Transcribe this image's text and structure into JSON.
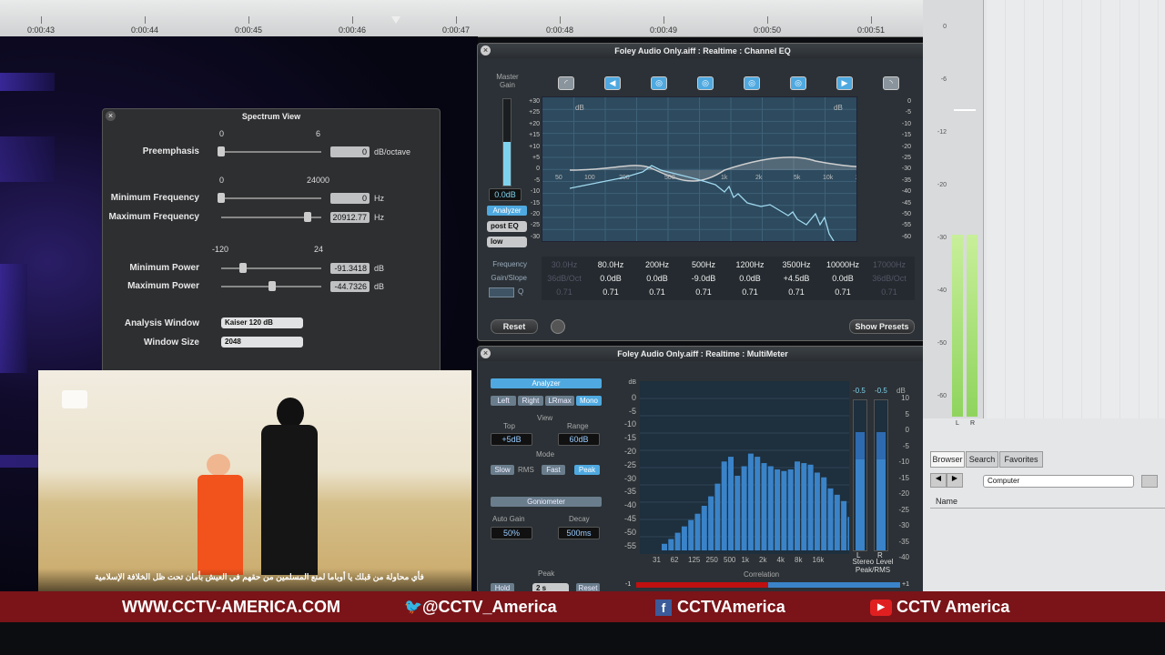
{
  "timeline": {
    "ticks": [
      "0:00:43",
      "0:00:44",
      "0:00:45",
      "0:00:46",
      "0:00:47",
      "0:00:48",
      "0:00:49",
      "0:00:50",
      "0:00:51"
    ]
  },
  "spectrum": {
    "title": "Spectrum View",
    "preemphasis_label": "Preemphasis",
    "preemphasis_min": "0",
    "preemphasis_max": "6",
    "preemphasis_value": "0",
    "preemphasis_unit": "dB/octave",
    "freq_min_label": "0",
    "freq_max_label": "24000",
    "min_freq_label": "Minimum Frequency",
    "min_freq_value": "0",
    "max_freq_label": "Maximum Frequency",
    "max_freq_value": "20912.77",
    "hz": "Hz",
    "power_min_label": "-120",
    "power_max_label": "24",
    "min_power_label": "Minimum Power",
    "min_power_value": "-91.3418",
    "max_power_label": "Maximum Power",
    "max_power_value": "-44.7326",
    "db": "dB",
    "window_label": "Analysis Window",
    "window_value": "Kaiser 120 dB",
    "size_label": "Window Size",
    "size_value": "2048"
  },
  "eq": {
    "title": "Foley Audio Only.aiff : Realtime : Channel EQ",
    "master_gain": "Master\nGain",
    "gain_value": "0.0dB",
    "analyzer": "Analyzer",
    "post_eq": "post EQ",
    "low": "low",
    "left_scale": [
      "+30",
      "+25",
      "+20",
      "+15",
      "+10",
      "+5",
      "0",
      "-5",
      "-10",
      "-15",
      "-20",
      "-25",
      "-30"
    ],
    "right_scale": [
      "0",
      "-5",
      "-10",
      "-15",
      "-20",
      "-25",
      "-30",
      "-35",
      "-40",
      "-45",
      "-50",
      "-55",
      "-60"
    ],
    "db_label": "dB",
    "freq_axis": [
      "20",
      "50",
      "100",
      "200",
      "500",
      "1k",
      "2k",
      "5k",
      "10k",
      "20k"
    ],
    "row_frequency": "Frequency",
    "row_gain": "Gain/Slope",
    "row_q": "Q",
    "bands": [
      {
        "freq": "30.0Hz",
        "gain": "36dB/Oct",
        "q": "0.71"
      },
      {
        "freq": "80.0Hz",
        "gain": "0.0dB",
        "q": "0.71"
      },
      {
        "freq": "200Hz",
        "gain": "0.0dB",
        "q": "0.71"
      },
      {
        "freq": "500Hz",
        "gain": "-9.0dB",
        "q": "0.71"
      },
      {
        "freq": "1200Hz",
        "gain": "0.0dB",
        "q": "0.71"
      },
      {
        "freq": "3500Hz",
        "gain": "+4.5dB",
        "q": "0.71"
      },
      {
        "freq": "10000Hz",
        "gain": "0.0dB",
        "q": "0.71"
      },
      {
        "freq": "17000Hz",
        "gain": "36dB/Oct",
        "q": "0.71"
      }
    ],
    "reset": "Reset",
    "show_presets": "Show Presets"
  },
  "multimeter": {
    "title": "Foley Audio Only.aiff : Realtime : MultiMeter",
    "analyzer": "Analyzer",
    "left": "Left",
    "right": "Right",
    "lrmax": "LRmax",
    "mono": "Mono",
    "view": "View",
    "top": "Top",
    "range": "Range",
    "top_value": "+5dB",
    "range_value": "60dB",
    "mode": "Mode",
    "slow": "Slow",
    "rms": "RMS",
    "fast": "Fast",
    "peak": "Peak",
    "goniometer": "Goniometer",
    "auto_gain": "Auto Gain",
    "decay": "Decay",
    "auto_gain_value": "50%",
    "decay_value": "500ms",
    "peak_section": "Peak",
    "hold": "Hold",
    "hold_value": "2 s",
    "reset": "Reset",
    "db_scale": [
      "dB",
      "0",
      "-5",
      "-10",
      "-15",
      "-20",
      "-25",
      "-30",
      "-35",
      "-40",
      "-45",
      "-50",
      "-55"
    ],
    "freq_axis": [
      "31",
      "62",
      "125",
      "250",
      "500",
      "1k",
      "2k",
      "4k",
      "8k",
      "16k"
    ],
    "bar_levels": [
      3,
      6,
      10,
      14,
      18,
      22,
      27,
      33,
      41,
      55,
      58,
      46,
      52,
      60,
      58,
      54,
      52,
      50,
      49,
      50,
      55,
      54,
      53,
      48,
      45,
      38,
      34,
      30,
      20
    ],
    "correlation": "Correlation",
    "corr_left": "-1",
    "corr_right": "+1",
    "level_scale": [
      "10",
      "5",
      "0",
      "-5",
      "-10",
      "-15",
      "-20",
      "-25",
      "-30",
      "-35",
      "-40"
    ],
    "peak_l": "-0.5",
    "peak_r": "-0.5",
    "db_unit": "dB",
    "l": "L",
    "r": "R",
    "stereo_level": "Stereo Level\nPeak/RMS"
  },
  "rightpane": {
    "meter_scale": [
      "0",
      "-6",
      "-12",
      "-20",
      "-30",
      "-40",
      "-50",
      "-60"
    ],
    "l": "L",
    "r": "R",
    "tabs": [
      "Browser",
      "Search",
      "Favorites"
    ],
    "location": "Computer",
    "name_header": "Name"
  },
  "video": {
    "subtitle": "فأي محاولة من قبلك يا أوباما لمنع المسلمين من حقهم في العيش بأمان تحت ظل الخلافة الإسلامية"
  },
  "lowerthird": {
    "website": "WWW.CCTV-AMERICA.COM",
    "twitter": "@CCTV_America",
    "facebook": "CCTVAmerica",
    "youtube": "CCTV America",
    "colors": {
      "bar": "#7a1418",
      "twitter": "#3aa0e8",
      "facebook": "#3b5b9a",
      "youtube": "#e02020"
    }
  }
}
